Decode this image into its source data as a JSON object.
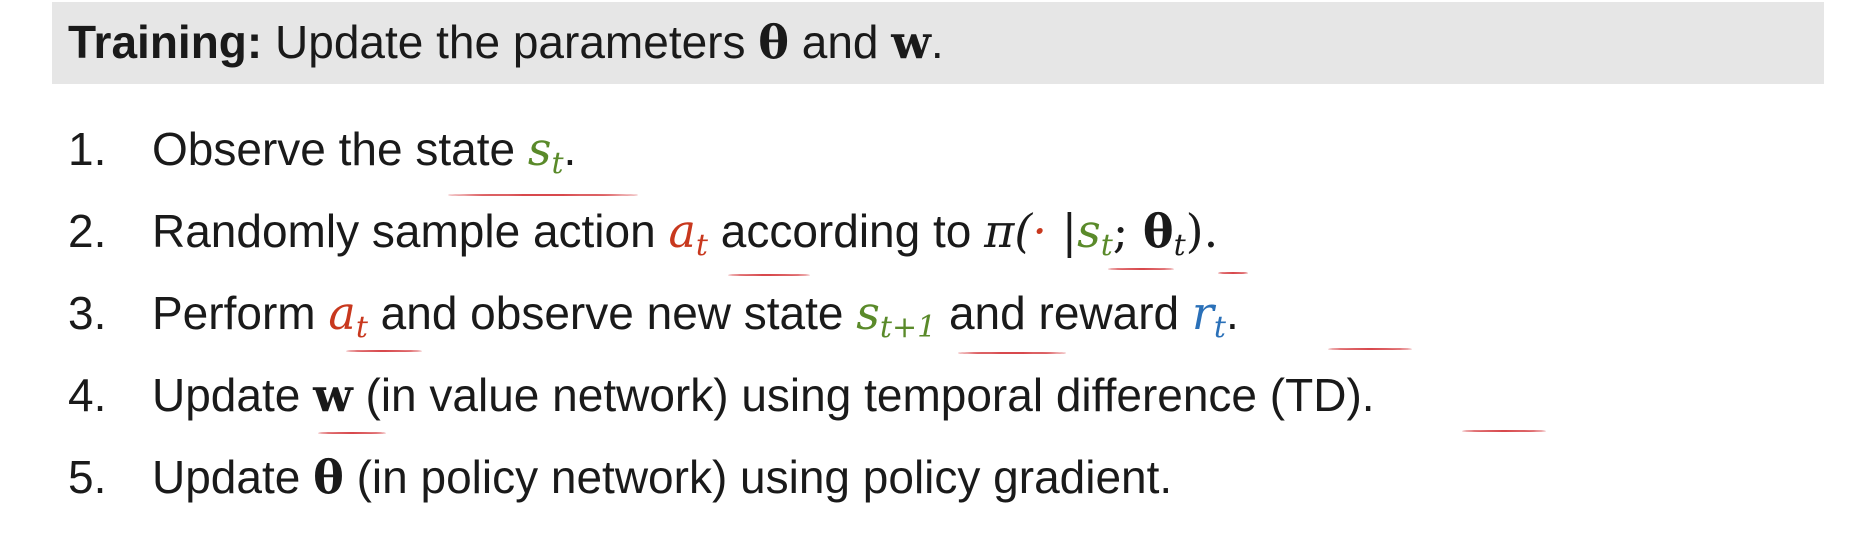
{
  "header": {
    "label": "Training:",
    "text_before": " Update the parameters ",
    "theta": "θ",
    "and": " and ",
    "w": "w",
    "period": "."
  },
  "steps": [
    {
      "num": "1.",
      "t1": "Observe the state ",
      "s": "s",
      "s_sub": "t",
      "end": "."
    },
    {
      "num": "2.",
      "t1": "Randomly sample action ",
      "a": "a",
      "a_sub": "t",
      "t2": " according to ",
      "pi": "π(",
      "dot": "·",
      "bar": " |",
      "s": "s",
      "s_sub": "t",
      "semi": "; ",
      "theta": "θ",
      "theta_sub": "t",
      "close": ").",
      "end": ""
    },
    {
      "num": "3.",
      "t1": "Perform ",
      "a": "a",
      "a_sub": "t",
      "t2": " and observe new state ",
      "s": "s",
      "s_sub": "t+1",
      "t3": " and reward ",
      "r": "r",
      "r_sub": "t",
      "end": "."
    },
    {
      "num": "4.",
      "t1": "Update ",
      "w": "w",
      "t2": " (in value network) using temporal difference (",
      "td": "TD",
      "end": ")."
    },
    {
      "num": "5.",
      "t1": "Update ",
      "theta": "θ",
      "t2": " (in policy network) using policy gradient."
    }
  ],
  "colors": {
    "state": "#5a8a2a",
    "action": "#c8381e",
    "reward": "#2a70b8",
    "underline": "#d8494d",
    "header_bg": "#e6e6e6"
  }
}
